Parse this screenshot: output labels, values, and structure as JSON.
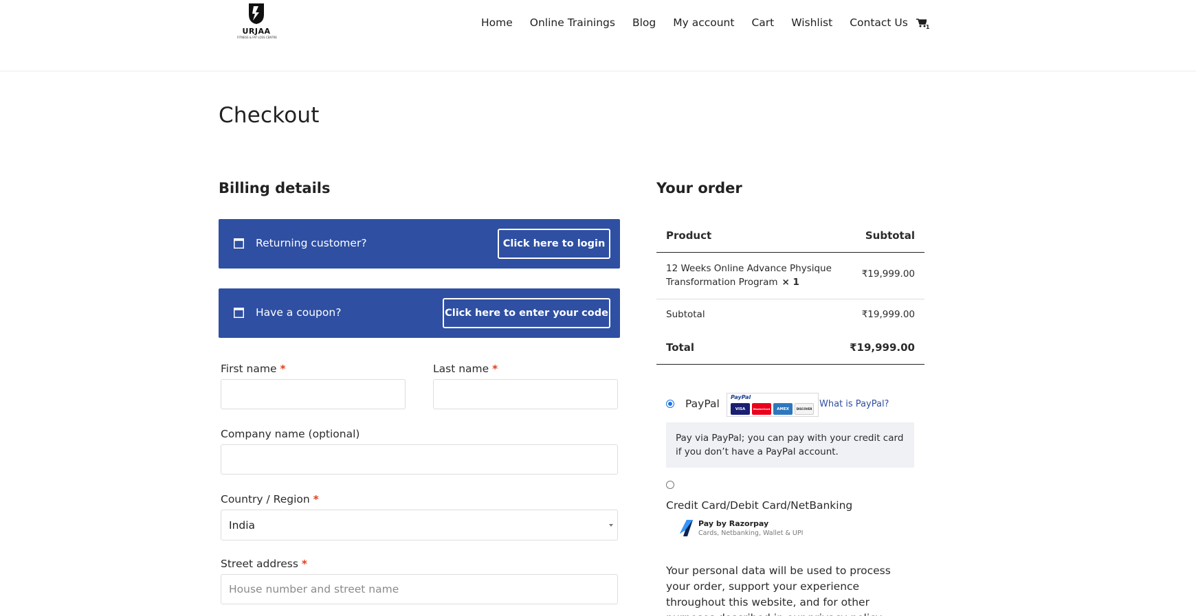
{
  "site": {
    "brand": "URJAA",
    "tagline": "FITNESS & FAT LOSS CENTRE"
  },
  "nav": {
    "items": [
      "Home",
      "Online Trainings",
      "Blog",
      "My account",
      "Cart",
      "Wishlist",
      "Contact Us"
    ],
    "cart_icon": "cart-icon",
    "cart_count": "1"
  },
  "page": {
    "title": "Checkout"
  },
  "billing": {
    "heading": "Billing details",
    "login_notice": {
      "text": "Returning customer?",
      "button": "Click here to login"
    },
    "coupon_notice": {
      "text": "Have a coupon?",
      "button": "Click here to enter your code"
    },
    "fields": {
      "first_name": {
        "label": "First name",
        "required": "*",
        "value": ""
      },
      "last_name": {
        "label": "Last name",
        "required": "*",
        "value": ""
      },
      "company": {
        "label": "Company name (optional)",
        "value": ""
      },
      "country": {
        "label": "Country / Region",
        "required": "*",
        "value": "India"
      },
      "street": {
        "label": "Street address",
        "required": "*",
        "placeholder": "House number and street name",
        "value": ""
      }
    }
  },
  "order": {
    "heading": "Your order",
    "columns": [
      "Product",
      "Subtotal"
    ],
    "items": [
      {
        "name": "12 Weeks Online Advance Physique Transformation Program",
        "qty": "× 1",
        "subtotal": "₹19,999.00"
      }
    ],
    "subtotal_label": "Subtotal",
    "subtotal_value": "₹19,999.00",
    "total_label": "Total",
    "total_value": "₹19,999.00"
  },
  "payment": {
    "paypal": {
      "label": "PayPal",
      "selected": true,
      "logo_word": "PayPal",
      "cards": [
        "VISA",
        "MasterCard",
        "AMEX",
        "DISCOVER"
      ],
      "link": "What is PayPal?",
      "description": "Pay via PayPal; you can pay with your credit card if you don’t have a PayPal account."
    },
    "razorpay": {
      "label": "Credit Card/Debit Card/NetBanking",
      "selected": false,
      "title": "Pay by Razorpay",
      "subtitle": "Cards, Netbanking, Wallet & UPI"
    }
  },
  "privacy_text": "Your personal data will be used to process your order, support your experience throughout this website, and for other purposes described in our privacy policy.",
  "colors": {
    "notice_bg": "#2f4fa2",
    "required": "#e2401c",
    "link": "#2f4fa2"
  }
}
